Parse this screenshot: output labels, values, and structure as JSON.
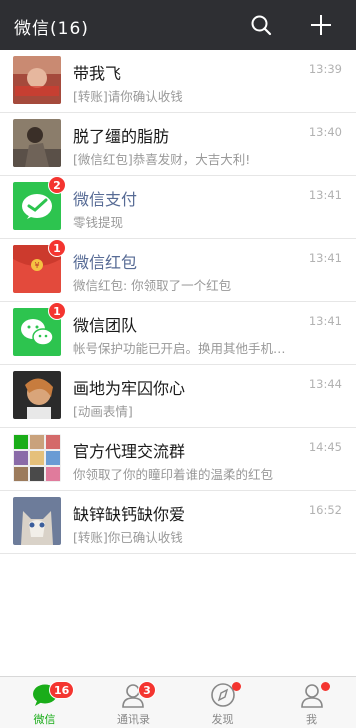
{
  "header": {
    "title": "微信(16)",
    "icons": [
      "search-icon",
      "plus-icon"
    ],
    "background": "#2e2f33"
  },
  "chats": [
    {
      "name": "带我飞",
      "message": "[转账]请你确认收钱",
      "time": "13:39",
      "official": false,
      "avatar": "photo"
    },
    {
      "name": "脱了缰的脂肪",
      "message": "[微信红包]恭喜发财，大吉大利!",
      "time": "13:40",
      "official": false,
      "avatar": "photo"
    },
    {
      "name": "微信支付",
      "message": "零钱提现",
      "time": "13:41",
      "official": true,
      "badge": "2",
      "avatar": "wechat-pay-icon"
    },
    {
      "name": "微信红包",
      "message": "微信红包: 你领取了一个红包",
      "time": "13:41",
      "official": true,
      "badge": "1",
      "avatar": "red-packet-icon"
    },
    {
      "name": "微信团队",
      "message": "帐号保护功能已开启。换用其他手机…",
      "time": "13:41",
      "official": false,
      "badge": "1",
      "avatar": "wechat-team-icon"
    },
    {
      "name": "画地为牢囚你心",
      "message": "[动画表情]",
      "time": "13:44",
      "official": false,
      "avatar": "photo"
    },
    {
      "name": "官方代理交流群",
      "message": "你领取了你的瞳印着谁的温柔的红包",
      "time": "14:45",
      "official": false,
      "avatar": "group"
    },
    {
      "name": "缺锌缺钙缺你爱",
      "message": "[转账]你已确认收钱",
      "time": "16:52",
      "official": false,
      "avatar": "photo-cat"
    }
  ],
  "tabbar": {
    "tabs": [
      {
        "label": "微信",
        "icon": "chat-icon",
        "badge": "16",
        "active": true
      },
      {
        "label": "通讯录",
        "icon": "contacts-icon",
        "badge": "3",
        "active": false
      },
      {
        "label": "发现",
        "icon": "compass-icon",
        "dot": true,
        "active": false
      },
      {
        "label": "我",
        "icon": "profile-icon",
        "dot": true,
        "active": false
      }
    ]
  },
  "colors": {
    "accent": "#1aad19",
    "badge": "#f43530",
    "official_name": "#576b95"
  }
}
